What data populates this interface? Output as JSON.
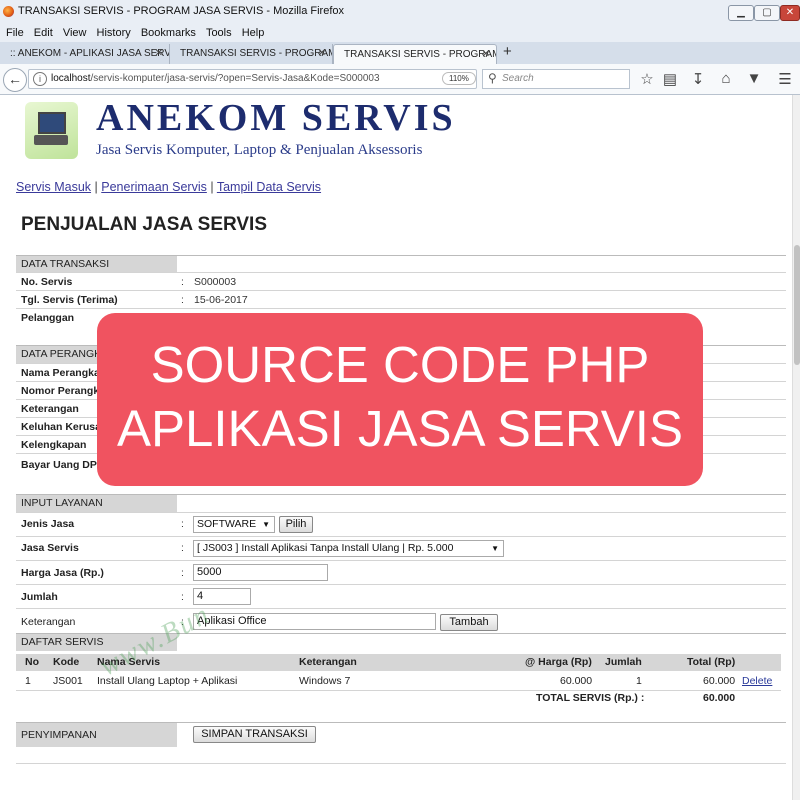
{
  "window": {
    "title": "TRANSAKSI SERVIS - PROGRAM JASA SERVIS - Mozilla Firefox",
    "min_label": "▁",
    "max_label": "▢",
    "close_label": "✕"
  },
  "menu": [
    "File",
    "Edit",
    "View",
    "History",
    "Bookmarks",
    "Tools",
    "Help"
  ],
  "tabs": [
    {
      "label": ":: ANEKOM - APLIKASI JASA SERVIS",
      "close": "✕"
    },
    {
      "label": "TRANSAKSI SERVIS - PROGRAM JASA SERVIS",
      "close": "✕"
    },
    {
      "label": "TRANSAKSI SERVIS - PROGRAM JASA SERVIS",
      "close": "✕"
    }
  ],
  "new_tab": "+",
  "nav": {
    "url_host": "localhost",
    "url_path": "/servis-komputer/jasa-servis/?open=Servis-Jasa&Kode=S000003",
    "zoom": "110%",
    "search_placeholder": "Search"
  },
  "icons": {
    "back": "back-arrow-icon",
    "info": "info-icon",
    "reload": "reload-icon",
    "search": "search-icon",
    "bookmark_star": "star-icon",
    "reading_list": "clipboard-icon",
    "download": "download-icon",
    "home": "home-icon",
    "pocket": "pocket-icon",
    "menu": "hamburger-menu-icon"
  },
  "site": {
    "brand": "ANEKOM SERVIS",
    "tagline": "Jasa Servis Komputer, Laptop & Penjualan Aksessoris",
    "links": [
      "Servis Masuk",
      "Penerimaan Servis",
      "Tampil Data Servis"
    ],
    "link_sep": "|"
  },
  "page_heading": "PENJUALAN JASA SERVIS",
  "colon": ":",
  "data_transaksi": {
    "section": "DATA TRANSAKSI",
    "no_servis_label": "No. Servis",
    "no_servis": "S000003",
    "tgl_label": "Tgl. Servis (Terima)",
    "tgl": "15-06-2017",
    "pelanggan_label": "Pelanggan"
  },
  "data_perangkat": {
    "section": "DATA PERANGK",
    "rows": [
      "Nama Perangka",
      "Nomor Perangk",
      "Keterangan",
      "Keluhan Kerusa",
      "Kelengkapan",
      "Bayar Uang DP"
    ]
  },
  "input_layanan": {
    "section": "INPUT LAYANAN",
    "jenis_label": "Jenis Jasa",
    "jenis_value": "SOFTWARE",
    "pilih": "Pilih",
    "jasa_label": "Jasa Servis",
    "jasa_value": "[ JS003 ] Install Aplikasi Tanpa Install Ulang | Rp. 5.000",
    "harga_label": "Harga Jasa (Rp.)",
    "harga_value": "5000",
    "jumlah_label": "Jumlah",
    "jumlah_value": "4",
    "ket_label": "Keterangan",
    "ket_value": "Aplikasi Office",
    "tambah": "Tambah"
  },
  "daftar_servis": {
    "section": "DAFTAR SERVIS",
    "headers": [
      "No",
      "Kode",
      "Nama Servis",
      "Keterangan",
      "@ Harga (Rp)",
      "Jumlah",
      "Total (Rp)"
    ],
    "rows": [
      {
        "no": "1",
        "kode": "JS001",
        "nama": "Install Ulang Laptop + Aplikasi",
        "ket": "Windows 7",
        "harga": "60.000",
        "jumlah": "1",
        "total": "60.000",
        "action": "Delete"
      }
    ],
    "total_label": "TOTAL SERVIS (Rp.) :",
    "total_value": "60.000"
  },
  "penyimpanan": {
    "section": "PENYIMPANAN",
    "simpan": "SIMPAN TRANSAKSI"
  },
  "overlay": {
    "line1": "SOURCE CODE PHP",
    "line2": "APLIKASI JASA SERVIS"
  },
  "watermark": "www.Bun"
}
